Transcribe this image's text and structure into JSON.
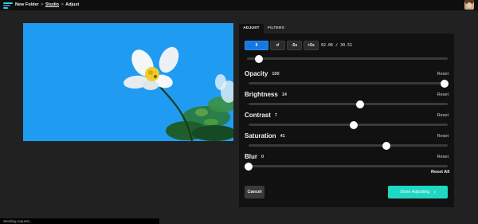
{
  "topbar": {
    "crumbs": [
      "New Folder",
      "Studio",
      "Adjust"
    ],
    "separator": ">"
  },
  "tabs": [
    {
      "label": "ADJUST",
      "active": true
    },
    {
      "label": "FILTERS",
      "active": false
    }
  ],
  "player": {
    "play_label": "II",
    "replay_label": "↺",
    "back_label": "-5s",
    "forward_label": "+5s",
    "current_time": "02.06",
    "time_separator": "/",
    "duration": "30.51",
    "progress": 0.03
  },
  "sliders": [
    {
      "label": "Opacity",
      "value": "100",
      "level": 1.0,
      "reset": "Reset"
    },
    {
      "label": "Brightness",
      "value": "14",
      "level": 0.57,
      "reset": "Reset"
    },
    {
      "label": "Contrast",
      "value": "7",
      "level": 0.535,
      "reset": "Reset"
    },
    {
      "label": "Saturation",
      "value": "41",
      "level": 0.705,
      "reset": "Reset"
    },
    {
      "label": "Blur",
      "value": "0",
      "level": 0.0,
      "reset": "Reset"
    }
  ],
  "reset_all": "Reset All",
  "footer": {
    "cancel_label": "Cancel",
    "done_label": "Done Adjusting",
    "done_icon": "chevron-right-icon"
  },
  "status": "Sending request...",
  "colors": {
    "accent": "#1fd8c4",
    "play": "#1577e0",
    "sky": "#1f9cf2",
    "panel": "#111111"
  }
}
